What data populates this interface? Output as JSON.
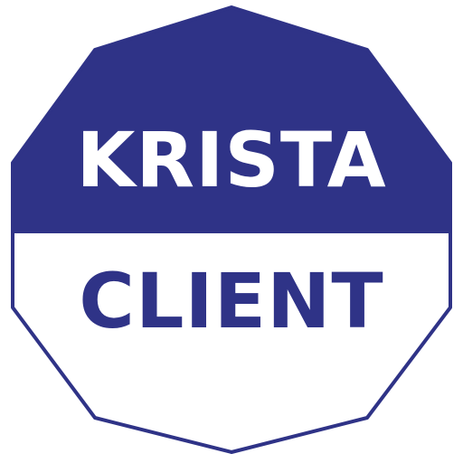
{
  "logo": {
    "line1": "KRISTA",
    "line2": "CLIENT"
  },
  "colors": {
    "primary": "#2f3387",
    "background": "#ffffff",
    "outline": "#2f3387",
    "text_top": "#ffffff",
    "text_bottom": "#2f3387"
  }
}
